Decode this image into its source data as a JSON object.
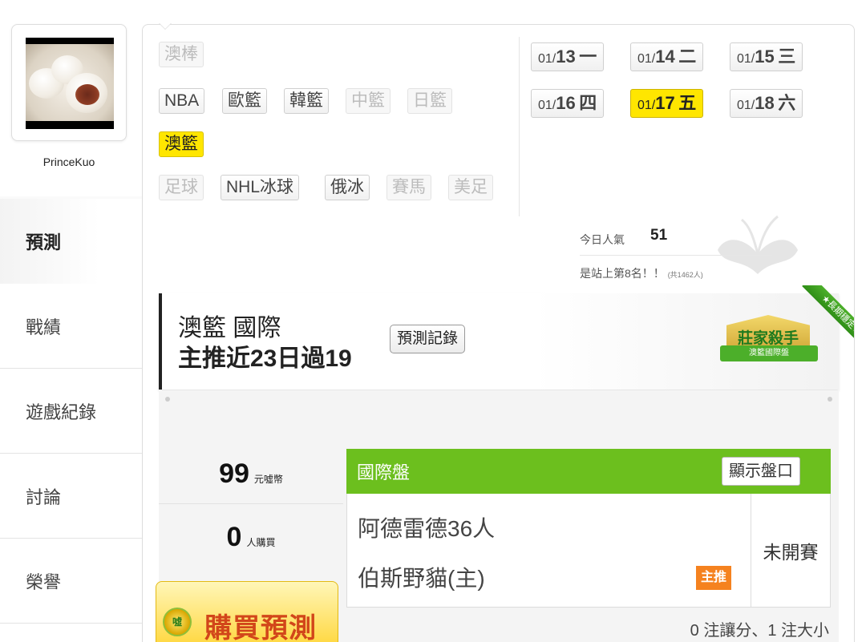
{
  "profile": {
    "username": "PrinceKuo",
    "avatar_alt": "avatar"
  },
  "nav": [
    {
      "id": "predict",
      "label": "預測",
      "active": true
    },
    {
      "id": "record",
      "label": "戰績",
      "active": false
    },
    {
      "id": "game-log",
      "label": "遊戲紀錄",
      "active": false
    },
    {
      "id": "discuss",
      "label": "討論",
      "active": false
    },
    {
      "id": "honor",
      "label": "榮譽",
      "active": false
    }
  ],
  "sports": {
    "row1": [
      "澳棒"
    ],
    "row2": [
      "NBA",
      "歐籃",
      "韓籃",
      "中籃",
      "日籃"
    ],
    "row3": [
      "澳籃"
    ],
    "row4": [
      "足球",
      "NHL冰球",
      "俄冰",
      "賽馬",
      "美足"
    ]
  },
  "dates": [
    {
      "prefix": "01/",
      "day": "13",
      "weekday": "一"
    },
    {
      "prefix": "01/",
      "day": "14",
      "weekday": "二"
    },
    {
      "prefix": "01/",
      "day": "15",
      "weekday": "三"
    },
    {
      "prefix": "01/",
      "day": "16",
      "weekday": "四"
    },
    {
      "prefix": "01/",
      "day": "17",
      "weekday": "五"
    },
    {
      "prefix": "01/",
      "day": "18",
      "weekday": "六"
    }
  ],
  "popularity": {
    "label": "今日人氣",
    "value": "51",
    "rank_text": "是站上第8名！！",
    "rank_total": "(共1462人)"
  },
  "header": {
    "league": "澳籃 國際",
    "record": "主推近23日過19",
    "history_button": "預測記錄"
  },
  "badge": {
    "title": "莊家殺手",
    "subtitle": "澳籃國際盤",
    "ribbon": "★長期穩定★"
  },
  "price": {
    "value": "99",
    "unit": "元噓幣"
  },
  "buyers": {
    "value": "0",
    "unit": "人購買"
  },
  "buy_button": {
    "icon": "噓",
    "label": "購買預測"
  },
  "pick": {
    "market": "國際盤",
    "show_button": "顯示盤口",
    "away_team": "阿德雷德36人",
    "home_team": "伯斯野貓(主)",
    "main_tag": "主推",
    "status": "未開賽"
  },
  "bets_summary": "0 注讓分、1 注大小",
  "colors": {
    "accent_green": "#6cbf1e",
    "highlight_yellow": "#ffe600",
    "tag_orange": "#f5821f",
    "buy_red": "#d2461a"
  }
}
